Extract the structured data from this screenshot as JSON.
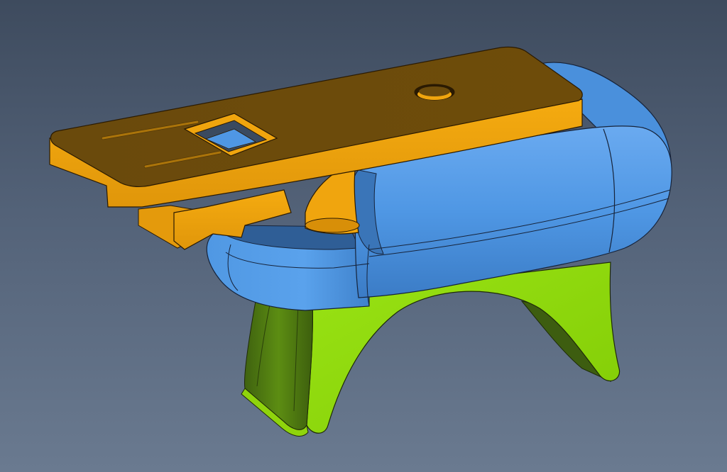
{
  "viewer": {
    "background_top": "#3e4b5e",
    "background_bottom": "#6a7a90"
  },
  "model": {
    "parts": [
      {
        "part": "top-plate",
        "color": "#f0a30c"
      },
      {
        "part": "clip-housing",
        "color": "#4f9ae6"
      },
      {
        "part": "saddle-base",
        "color": "#90dc0a"
      }
    ]
  }
}
